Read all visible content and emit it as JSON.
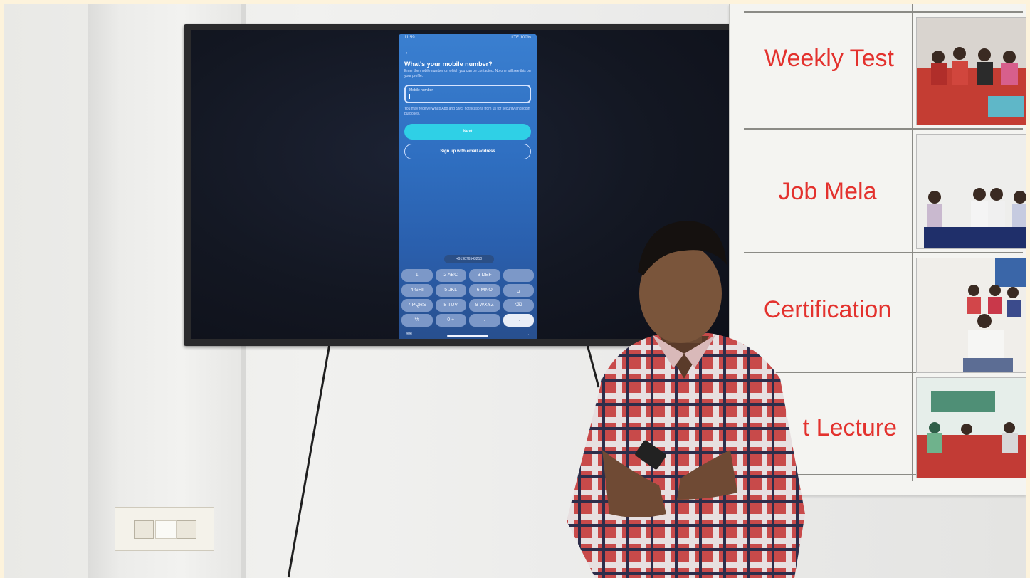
{
  "phone_screen": {
    "status_left": "11:59",
    "status_right": "LTE 100%",
    "title": "What's your mobile number?",
    "subtitle": "Enter the mobile number on which you can be contacted. No one will see this on your profile.",
    "field_label": "Mobile number",
    "hint": "You may receive WhatsApp and SMS notifications from us for security and login purposes.",
    "next_button": "Next",
    "email_button": "Sign up with email address",
    "suggestion": "+919876543210",
    "keys": [
      "1",
      "2 ABC",
      "3 DEF",
      "–",
      "4 GHI",
      "5 JKL",
      "6 MNO",
      "␣",
      "7 PQRS",
      "8 TUV",
      "9 WXYZ",
      "⌫",
      "*#",
      "0 +",
      ".",
      "→"
    ]
  },
  "board": {
    "labels": [
      "Weekly Test",
      "Job Mela",
      "Certification",
      "t Lecture"
    ]
  },
  "colors": {
    "board_text": "#e3322e",
    "phone_bg": "#2f6fc1",
    "next_button": "#2fd0e6"
  }
}
